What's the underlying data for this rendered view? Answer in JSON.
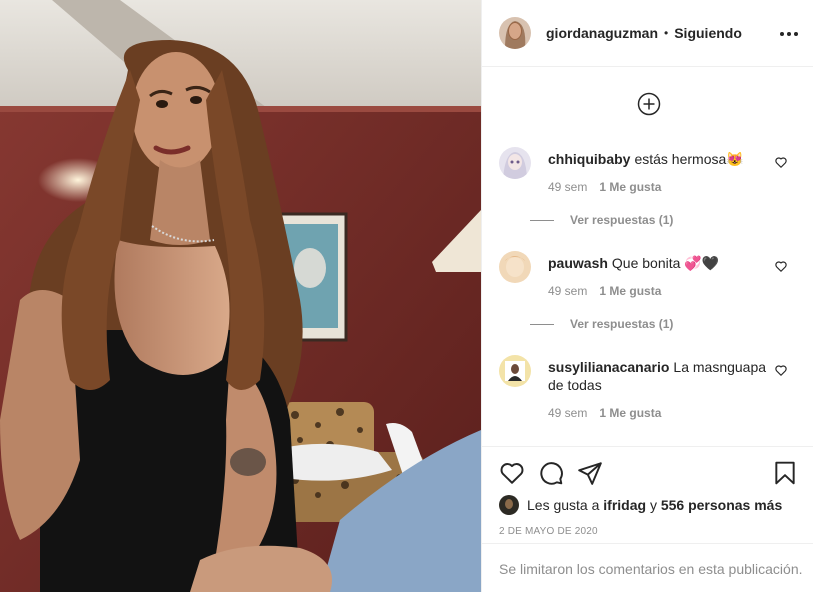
{
  "post": {
    "username": "giordanaguzman",
    "separator": "•",
    "follow_status": "Siguiendo",
    "photo_alt": "foto de la publicación",
    "icons": {
      "more": "more-dots-icon",
      "load_more": "plus-circle-icon",
      "like": "heart-icon",
      "comment": "comment-bubble-icon",
      "share": "paper-plane-icon",
      "save": "bookmark-icon"
    }
  },
  "comments": [
    {
      "author": "chhiquibaby",
      "text": "estás hermosa",
      "emoji": "😻",
      "time": "49 sem",
      "likes": "1 Me gusta",
      "replies": "Ver respuestas (1)"
    },
    {
      "author": "pauwash",
      "text": "Que bonita",
      "emoji": "💞🖤",
      "time": "49 sem",
      "likes": "1 Me gusta",
      "replies": "Ver respuestas (1)"
    },
    {
      "author": "susylilianacanario",
      "text": "La masnguapa de todas",
      "emoji": "",
      "time": "49 sem",
      "likes": "1 Me gusta"
    }
  ],
  "likes": {
    "prefix": "Les gusta a",
    "user": "ifridag",
    "connector": "y",
    "others": "556 personas más"
  },
  "date": "2 DE MAYO DE 2020",
  "comments_disabled": "Se limitaron los comentarios en esta publicación.",
  "colors": {
    "text": "#262626",
    "secondary": "#8e8e8e",
    "divider": "#efefef",
    "wall": "#7a2e2a"
  }
}
